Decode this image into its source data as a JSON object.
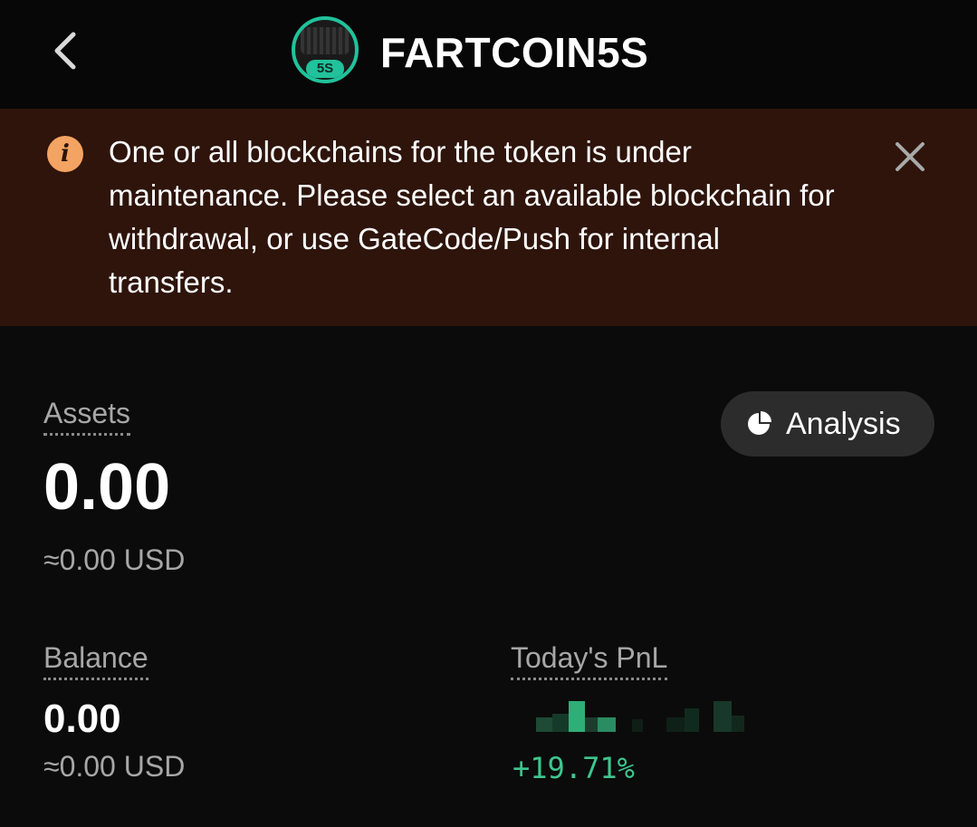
{
  "header": {
    "title": "FARTCOIN5S",
    "logo_tag": "5S"
  },
  "banner": {
    "message": "One or all blockchains for the token is under maintenance. Please select an available blockchain for withdrawal, or use GateCode/Push for internal transfers.",
    "info_glyph": "i"
  },
  "assets": {
    "label": "Assets",
    "value": "0.00",
    "usd": "≈0.00 USD",
    "analysis_label": "Analysis"
  },
  "balance": {
    "label": "Balance",
    "value": "0.00",
    "usd": "≈0.00 USD"
  },
  "pnl": {
    "label": "Today's PnL",
    "percent": "+19.71%"
  },
  "colors": {
    "banner_bg": "#2e140b",
    "info_icon": "#f4a462",
    "accent_green": "#3ec68e",
    "logo_ring": "#21c29b"
  },
  "icons": [
    "chevron-left-icon",
    "token-logo-icon",
    "info-icon",
    "close-icon",
    "pie-chart-icon"
  ]
}
